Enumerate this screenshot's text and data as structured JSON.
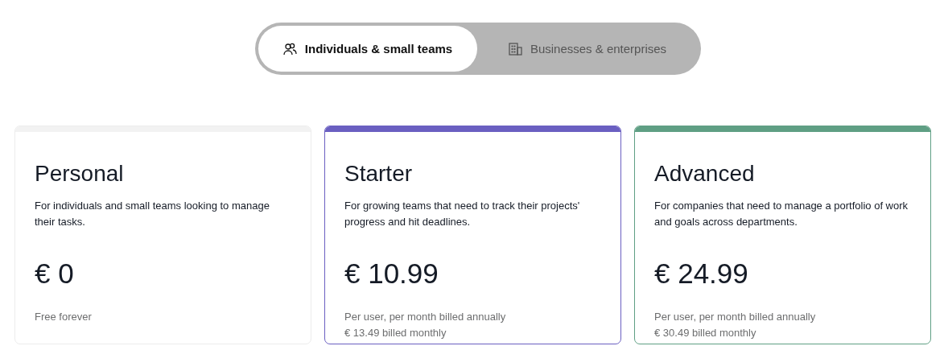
{
  "segment_tabs": [
    {
      "label": "Individuals & small teams",
      "selected": true
    },
    {
      "label": "Businesses & enterprises",
      "selected": false
    }
  ],
  "plans": [
    {
      "name": "Personal",
      "description": "For individuals and small teams looking to manage their tasks.",
      "price": "€ 0",
      "notes": [
        "Free forever"
      ],
      "color": "#f2f2f2"
    },
    {
      "name": "Starter",
      "description": "For growing teams that need to track their projects' progress and hit deadlines.",
      "price": "€ 10.99",
      "notes": [
        "Per user, per month billed annually",
        "€ 13.49 billed monthly"
      ],
      "color": "#6a5fc1"
    },
    {
      "name": "Advanced",
      "description": "For companies that need to manage a portfolio of work and goals across departments.",
      "price": "€ 24.99",
      "notes": [
        "Per user, per month billed annually",
        "€ 30.49 billed monthly"
      ],
      "color": "#5f9f84"
    }
  ]
}
